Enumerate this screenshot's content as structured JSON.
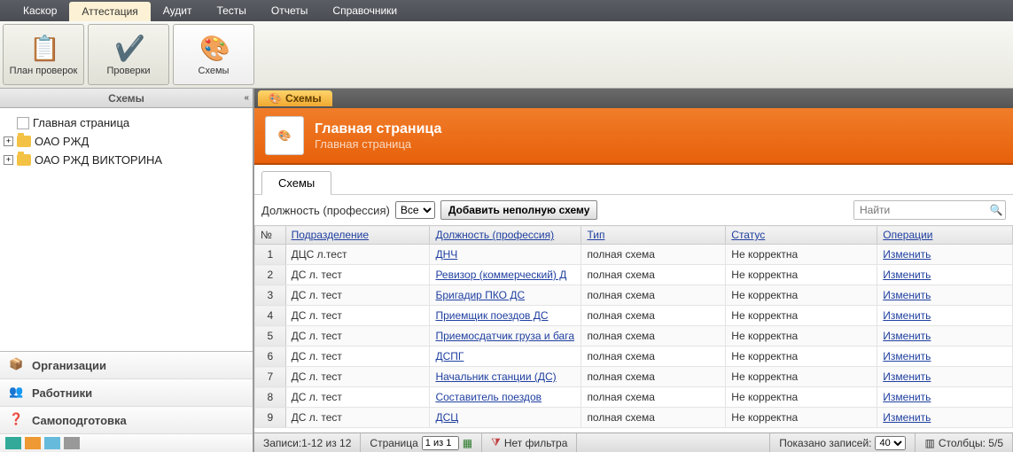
{
  "topTabs": [
    "Каскор",
    "Аттестация",
    "Аудит",
    "Тесты",
    "Отчеты",
    "Справочники"
  ],
  "topActive": 1,
  "ribbon": [
    {
      "label": "План проверок"
    },
    {
      "label": "Проверки"
    },
    {
      "label": "Схемы"
    }
  ],
  "sidebar": {
    "title": "Схемы",
    "tree": [
      {
        "label": "Главная страница",
        "type": "doc",
        "expand": ""
      },
      {
        "label": "ОАО РЖД",
        "type": "folder",
        "expand": "+"
      },
      {
        "label": "ОАО РЖД ВИКТОРИНА",
        "type": "folder",
        "expand": "+"
      }
    ],
    "nav": [
      {
        "label": "Организации"
      },
      {
        "label": "Работники"
      },
      {
        "label": "Самоподготовка"
      }
    ]
  },
  "mainTab": "Схемы",
  "hero": {
    "title": "Главная страница",
    "sub": "Главная страница"
  },
  "contentTab": "Схемы",
  "toolbar": {
    "label": "Должность (профессия)",
    "select": "Все",
    "button": "Добавить неполную схему",
    "searchPlaceholder": "Найти"
  },
  "columns": [
    "№",
    "Подразделение",
    "Должность (профессия)",
    "Тип",
    "Статус",
    "Операции"
  ],
  "colWidths": [
    "34px",
    "160px",
    "168px",
    "160px",
    "168px",
    "150px"
  ],
  "rows": [
    {
      "n": "1",
      "dept": "ДЦС л.тест",
      "pos": "ДНЧ",
      "type": "полная схема",
      "status": "Не корректна",
      "op": "Изменить"
    },
    {
      "n": "2",
      "dept": "ДС л. тест",
      "pos": "Ревизор (коммерческий) Д",
      "type": "полная схема",
      "status": "Не корректна",
      "op": "Изменить"
    },
    {
      "n": "3",
      "dept": "ДС л. тест",
      "pos": "Бригадир ПКО ДС",
      "type": "полная схема",
      "status": "Не корректна",
      "op": "Изменить"
    },
    {
      "n": "4",
      "dept": "ДС л. тест",
      "pos": "Приемщик поездов ДС",
      "type": "полная схема",
      "status": "Не корректна",
      "op": "Изменить"
    },
    {
      "n": "5",
      "dept": "ДС л. тест",
      "pos": "Приемосдатчик груза и бага",
      "type": "полная схема",
      "status": "Не корректна",
      "op": "Изменить"
    },
    {
      "n": "6",
      "dept": "ДС л. тест",
      "pos": "ДСПГ",
      "type": "полная схема",
      "status": "Не корректна",
      "op": "Изменить"
    },
    {
      "n": "7",
      "dept": "ДС л. тест",
      "pos": "Начальник станции (ДС)",
      "type": "полная схема",
      "status": "Не корректна",
      "op": "Изменить"
    },
    {
      "n": "8",
      "dept": "ДС л. тест",
      "pos": "Составитель поездов",
      "type": "полная схема",
      "status": "Не корректна",
      "op": "Изменить"
    },
    {
      "n": "9",
      "dept": "ДС л. тест",
      "pos": "ДСЦ",
      "type": "полная схема",
      "status": "Не корректна",
      "op": "Изменить"
    }
  ],
  "status": {
    "records": "Записи:1-12 из 12",
    "pageLabel": "Страница",
    "pageValue": "1 из 1",
    "filter": "Нет фильтра",
    "shown": "Показано записей:",
    "shownVal": "40",
    "cols": "Столбцы: 5/5"
  }
}
